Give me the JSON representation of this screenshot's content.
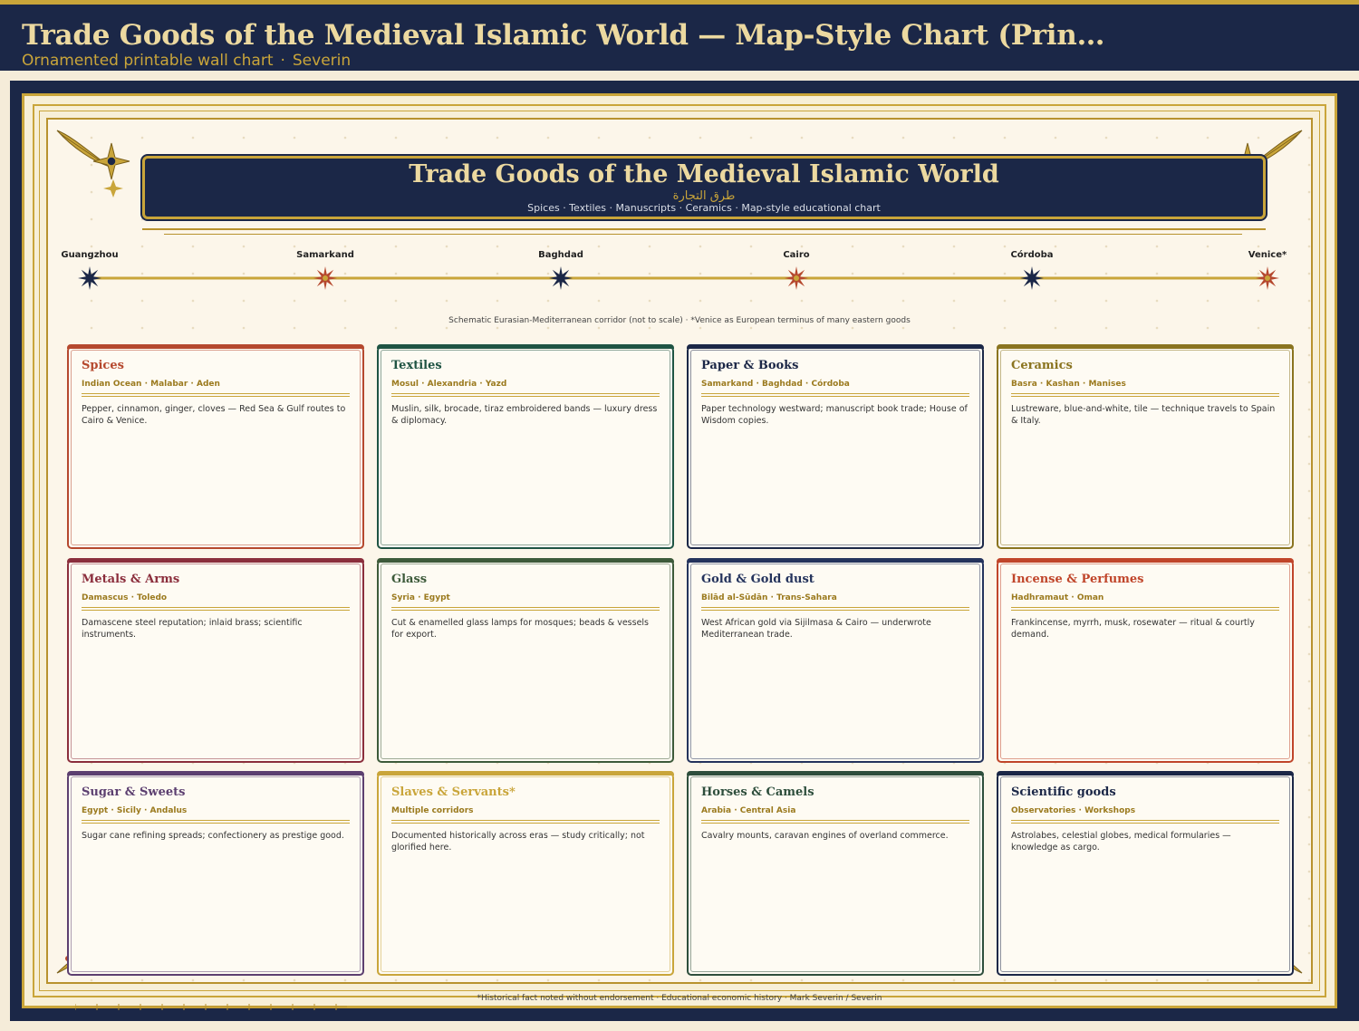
{
  "header": {
    "title": "Trade Goods of the Medieval Islamic World — Map-Style Chart (Prin…",
    "subtitle_left": "Ornamented printable wall chart",
    "subtitle_sep": "·",
    "subtitle_right": "Severin"
  },
  "banner": {
    "title": "Trade Goods of the Medieval Islamic World",
    "arabic": "طرق التجارة",
    "subtitle": "Spices · Textiles · Manuscripts · Ceramics  ·  Map-style educational chart"
  },
  "route": {
    "cities": [
      {
        "name": "Guangzhou",
        "style": "dark"
      },
      {
        "name": "Samarkand",
        "style": "red"
      },
      {
        "name": "Baghdad",
        "style": "dark"
      },
      {
        "name": "Cairo",
        "style": "red"
      },
      {
        "name": "Córdoba",
        "style": "dark"
      },
      {
        "name": "Venice*",
        "style": "red"
      }
    ],
    "note": "Schematic Eurasian-Mediterranean corridor (not to scale)  ·  *Venice as European terminus of many eastern goods"
  },
  "cards": [
    {
      "title": "Spices",
      "places": "Indian Ocean · Malabar · Aden",
      "desc": "Pepper, cinnamon, ginger, cloves — Red Sea & Gulf routes to Cairo & Venice.",
      "color": "#b5482e"
    },
    {
      "title": "Textiles",
      "places": "Mosul · Alexandria · Yazd",
      "desc": "Muslin, silk, brocade, tiraz embroidered bands — luxury dress & diplomacy.",
      "color": "#1f5444"
    },
    {
      "title": "Paper & Books",
      "places": "Samarkand · Baghdad · Córdoba",
      "desc": "Paper technology westward; manuscript book trade; House of Wisdom copies.",
      "color": "#1b2747"
    },
    {
      "title": "Ceramics",
      "places": "Basra · Kashan · Manises",
      "desc": "Lustreware, blue-and-white, tile — technique travels to Spain & Italy.",
      "color": "#8a7420"
    },
    {
      "title": "Metals & Arms",
      "places": "Damascus · Toledo",
      "desc": "Damascene steel reputation; inlaid brass; scientific instruments.",
      "color": "#8b2e3c"
    },
    {
      "title": "Glass",
      "places": "Syria · Egypt",
      "desc": "Cut & enamelled glass lamps for mosques; beads & vessels for export.",
      "color": "#3d5a3a"
    },
    {
      "title": "Gold & Gold dust",
      "places": "Bilād al-Sūdān · Trans-Sahara",
      "desc": "West African gold via Sijilmasa & Cairo — underwrote Mediterranean trade.",
      "color": "#24335c"
    },
    {
      "title": "Incense & Perfumes",
      "places": "Hadhramaut · Oman",
      "desc": "Frankincense, myrrh, musk, rosewater — ritual & courtly demand.",
      "color": "#c0452a"
    },
    {
      "title": "Sugar & Sweets",
      "places": "Egypt · Sicily · Andalus",
      "desc": "Sugar cane refining spreads; confectionery as prestige good.",
      "color": "#5c3f70"
    },
    {
      "title": "Slaves & Servants*",
      "places": "Multiple corridors",
      "desc": "Documented historically across eras — study critically; not glorified here.",
      "color": "#c9a53a"
    },
    {
      "title": "Horses & Camels",
      "places": "Arabia · Central Asia",
      "desc": "Cavalry mounts, caravan engines of overland commerce.",
      "color": "#2e4e3c"
    },
    {
      "title": "Scientific goods",
      "places": "Observatories · Workshops",
      "desc": "Astrolabes, celestial globes, medical formularies — knowledge as cargo.",
      "color": "#1b2747"
    }
  ],
  "footer": "*Historical fact noted without endorsement · Educational economic history · Mark Severin / Severin",
  "colors": {
    "navy": "#1b2747",
    "gold": "#c9a53a",
    "cream": "#fcf6ea",
    "red_star": "#b5482e"
  }
}
